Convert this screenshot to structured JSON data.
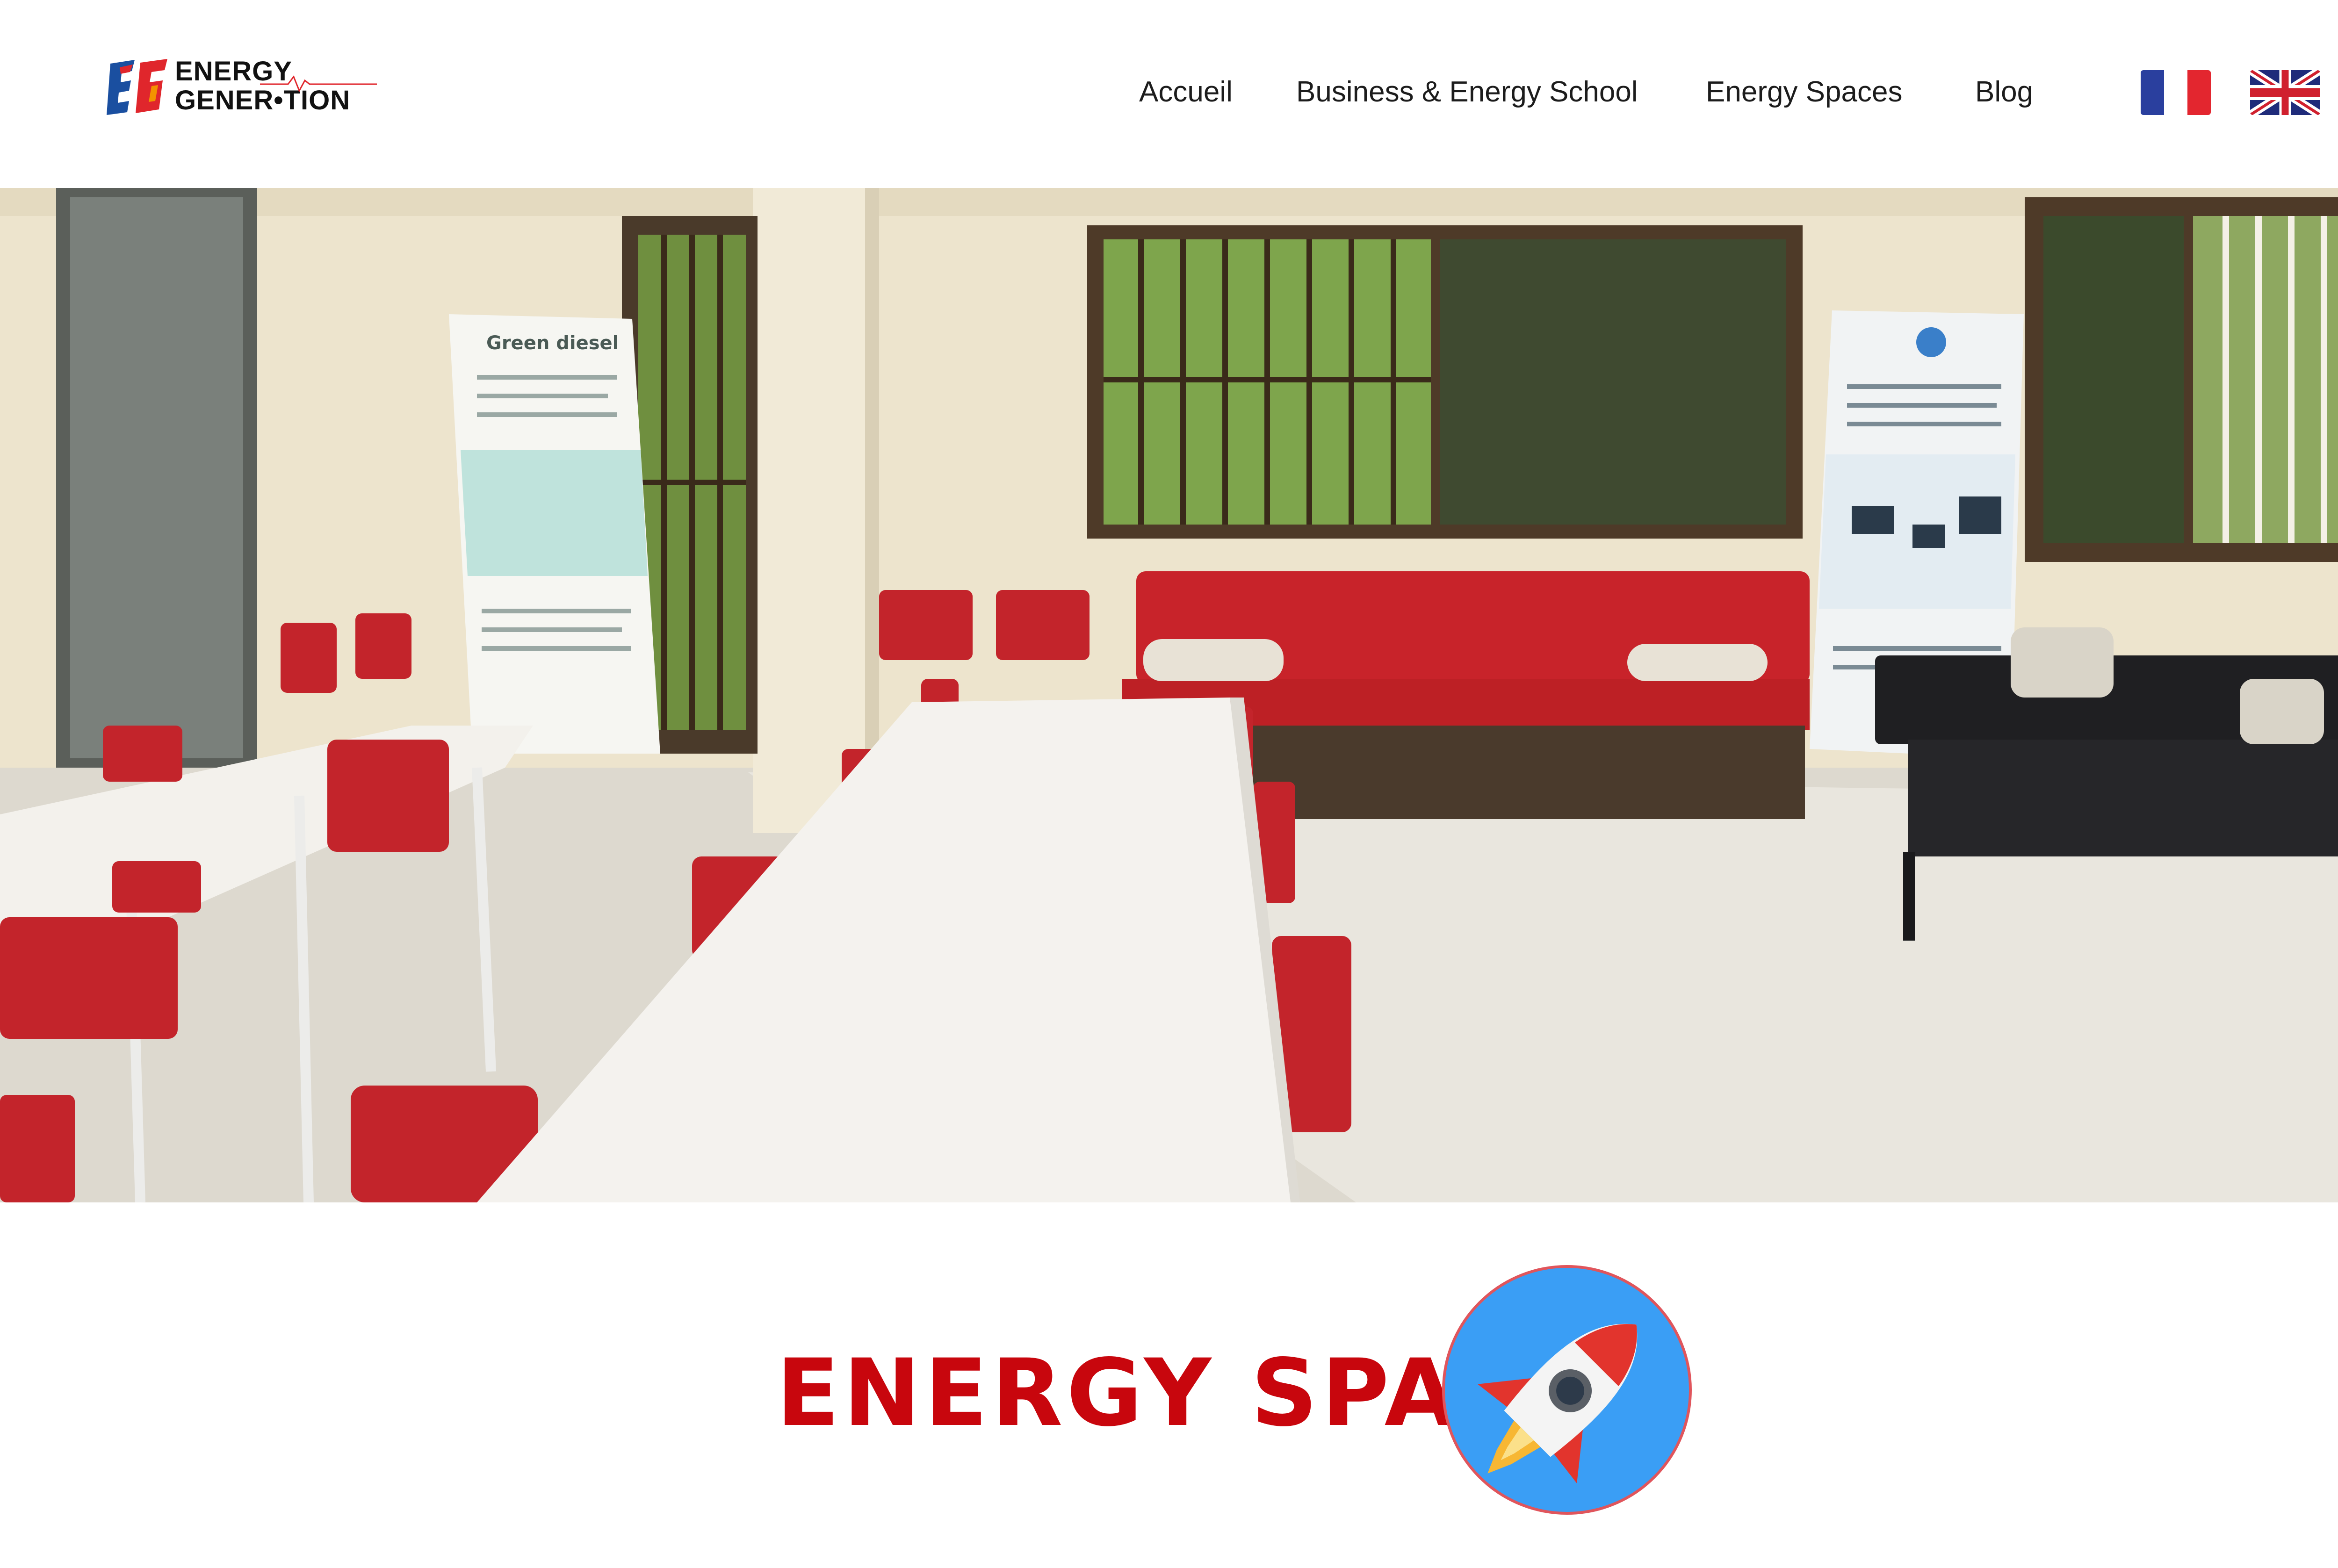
{
  "header": {
    "logo": {
      "line1": "ENERGY",
      "line2": "GENER•TION",
      "colors": {
        "blue": "#1a4fa0",
        "red": "#e0262c",
        "orange": "#f39200"
      }
    },
    "nav": [
      {
        "label": "Accueil"
      },
      {
        "label": "Business & Energy School"
      },
      {
        "label": "Energy Spaces"
      },
      {
        "label": "Blog"
      }
    ],
    "languages": [
      {
        "icon": "flag-fr-icon"
      },
      {
        "icon": "flag-uk-icon"
      }
    ]
  },
  "hero": {
    "banner_left": {
      "title": "Green diesel"
    },
    "icon": "photo-coworking-room"
  },
  "section": {
    "title": "ENERGY SPACE",
    "title_color": "#c8060d",
    "badge_icon": "rocket-icon",
    "badge_color": "#3a9ef5"
  }
}
